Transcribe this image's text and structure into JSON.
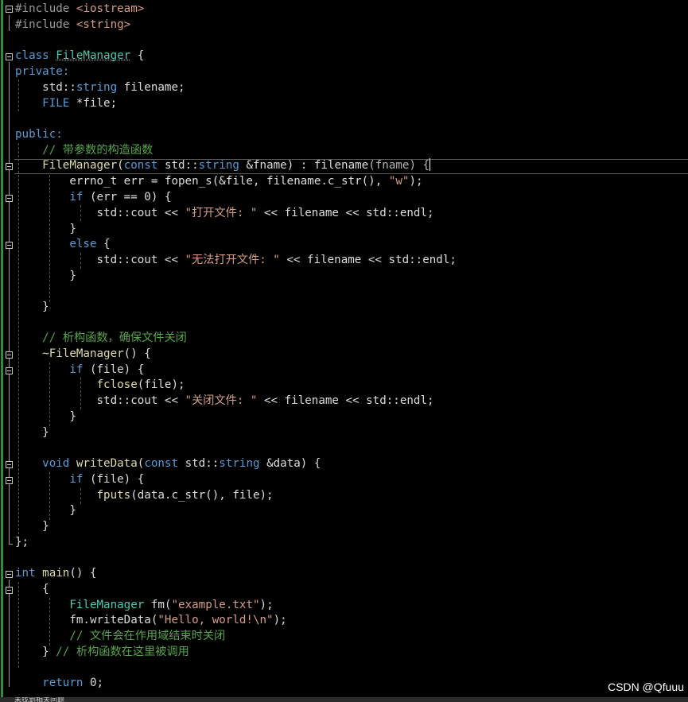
{
  "code": {
    "l1_a": "#include ",
    "l1_b": "<iostream>",
    "l2_a": "#include ",
    "l2_b": "<string>",
    "l4_kw": "class",
    "l4_name": "FileManager",
    "l4_brace": " {",
    "l5": "private:",
    "l6_ns": "std::",
    "l6_ty": "string",
    "l6_rest": " filename;",
    "l7_ty": "FILE",
    "l7_rest": " *file;",
    "l9": "public:",
    "l10": "// 带参数的构造函数",
    "l11_a": "FileManager",
    "l11_b": "(",
    "l11_c": "const",
    "l11_d": " std::",
    "l11_e": "string",
    "l11_f": " &fname) : filename",
    "l11_g": "(fname) {",
    "l12_a": "errno_t err = fopen_s(&file, filename.c_str(), ",
    "l12_b": "\"w\"",
    "l12_c": ");",
    "l13_kw": "if",
    "l13_rest": " (err == 0) {",
    "l14_a": "std::cout << ",
    "l14_b": "\"打开文件: \"",
    "l14_c": " << filename << std::endl;",
    "l15": "}",
    "l16_kw": "else",
    "l16_rest": " {",
    "l17_a": "std::cout << ",
    "l17_b": "\"无法打开文件: \"",
    "l17_c": " << filename << std::endl;",
    "l18": "}",
    "l20": "}",
    "l22": "// 析构函数，确保文件关闭",
    "l23_a": "~FileManager",
    "l23_b": "() {",
    "l24_kw": "if",
    "l24_rest": " (file) {",
    "l25_a": "fclose",
    "l25_b": "(file);",
    "l26_a": "std::cout << ",
    "l26_b": "\"关闭文件: \"",
    "l26_c": " << filename << std::endl;",
    "l27": "}",
    "l28": "}",
    "l30_kw": "void",
    "l30_fn": " writeData",
    "l30_b": "(",
    "l30_c": "const",
    "l30_d": " std::",
    "l30_e": "string",
    "l30_f": " &data) {",
    "l31_kw": "if",
    "l31_rest": " (file) {",
    "l32_a": "fputs",
    "l32_b": "(data.c_str(), file);",
    "l33": "}",
    "l34": "}",
    "l35": "};",
    "l37_kw": "int",
    "l37_fn": " main",
    "l37_rest": "() {",
    "l38": "{",
    "l39_a": "FileManager",
    "l39_b": " fm(",
    "l39_c": "\"example.txt\"",
    "l39_d": ");",
    "l40_a": "fm.writeData(",
    "l40_b": "\"Hello, world!\\n\"",
    "l40_c": ");",
    "l41": "// 文件会在作用域结束时关闭",
    "l42_a": "} ",
    "l42_b": "// 析构函数在这里被调用",
    "l44_kw": "return",
    "l44_rest": " 0;"
  },
  "watermark": "CSDN @Qfuuu",
  "status": "未找到相关问题"
}
